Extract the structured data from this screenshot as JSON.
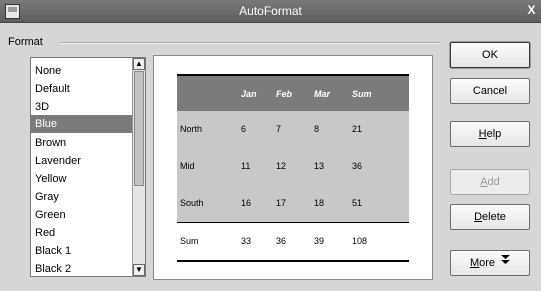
{
  "window": {
    "title": "AutoFormat",
    "close_glyph": "X"
  },
  "format": {
    "label": "Format",
    "items": [
      "None",
      "Default",
      "3D",
      "Blue",
      "Brown",
      "Lavender",
      "Yellow",
      "Gray",
      "Green",
      "Red",
      "Black 1",
      "Black 2"
    ],
    "selected": "Blue"
  },
  "preview": {
    "header": [
      "",
      "Jan",
      "Feb",
      "Mar",
      "Sum"
    ],
    "rows": [
      [
        "North",
        "6",
        "7",
        "8",
        "21"
      ],
      [
        "Mid",
        "11",
        "12",
        "13",
        "36"
      ],
      [
        "South",
        "16",
        "17",
        "18",
        "51"
      ],
      [
        "Sum",
        "33",
        "36",
        "39",
        "108"
      ]
    ]
  },
  "buttons": {
    "ok": "OK",
    "cancel": "Cancel",
    "help_mn": "H",
    "help_rest": "elp",
    "add_mn": "A",
    "add_rest": "dd",
    "delete_mn": "D",
    "delete_rest": "elete",
    "more_mn": "M",
    "more_rest": "ore"
  },
  "colors": {
    "header": "#7b7b7b",
    "body": "#c8c8c8",
    "selection": "#7b7b7b"
  },
  "icons": {
    "more": "double-chevron-down-icon",
    "scroll_up": "triangle-up-icon",
    "scroll_down": "triangle-down-icon"
  }
}
